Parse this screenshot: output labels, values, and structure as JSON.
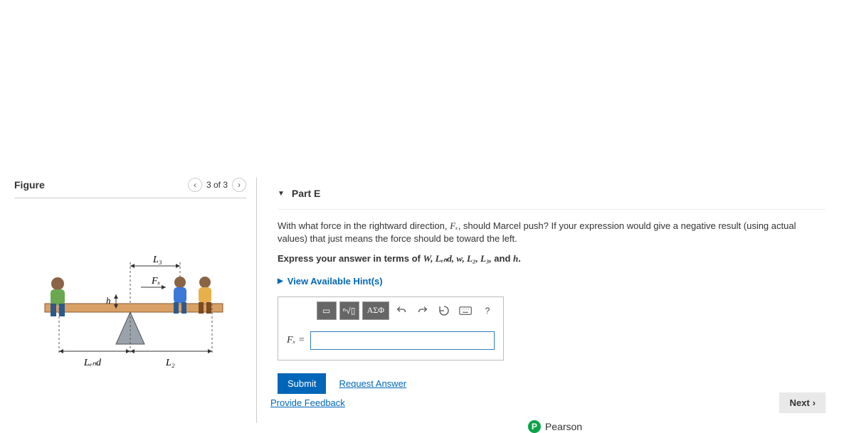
{
  "figure": {
    "title": "Figure",
    "pager": "3 of 3",
    "labels": {
      "L3": "L₃",
      "Fx": "Fₓ",
      "h": "h",
      "Lend": "Lₑₙd",
      "L2": "L₂"
    }
  },
  "part": {
    "label": "Part E",
    "question_prefix": "With what force in the rightward direction, ",
    "question_fx": "Fₓ",
    "question_mid": ", should Marcel push? If your expression would give a negative result (using actual values) that just means the force should be toward the left.",
    "express_prefix": "Express your answer in terms of ",
    "vars_html": "W, Lₑₙd, w, L₂, L₃,",
    "express_suffix_and": " and ",
    "express_h": "h",
    "express_period": ".",
    "hints_label": "View Available Hint(s)",
    "toolbar": {
      "template": "▭",
      "root": "ⁿ√▯",
      "greek": "ΑΣΦ",
      "question": "?"
    },
    "input_label": "Fₓ =",
    "submit": "Submit",
    "request": "Request Answer"
  },
  "footer": {
    "feedback": "Provide Feedback",
    "next": "Next",
    "brand": "Pearson",
    "brand_initial": "P"
  }
}
